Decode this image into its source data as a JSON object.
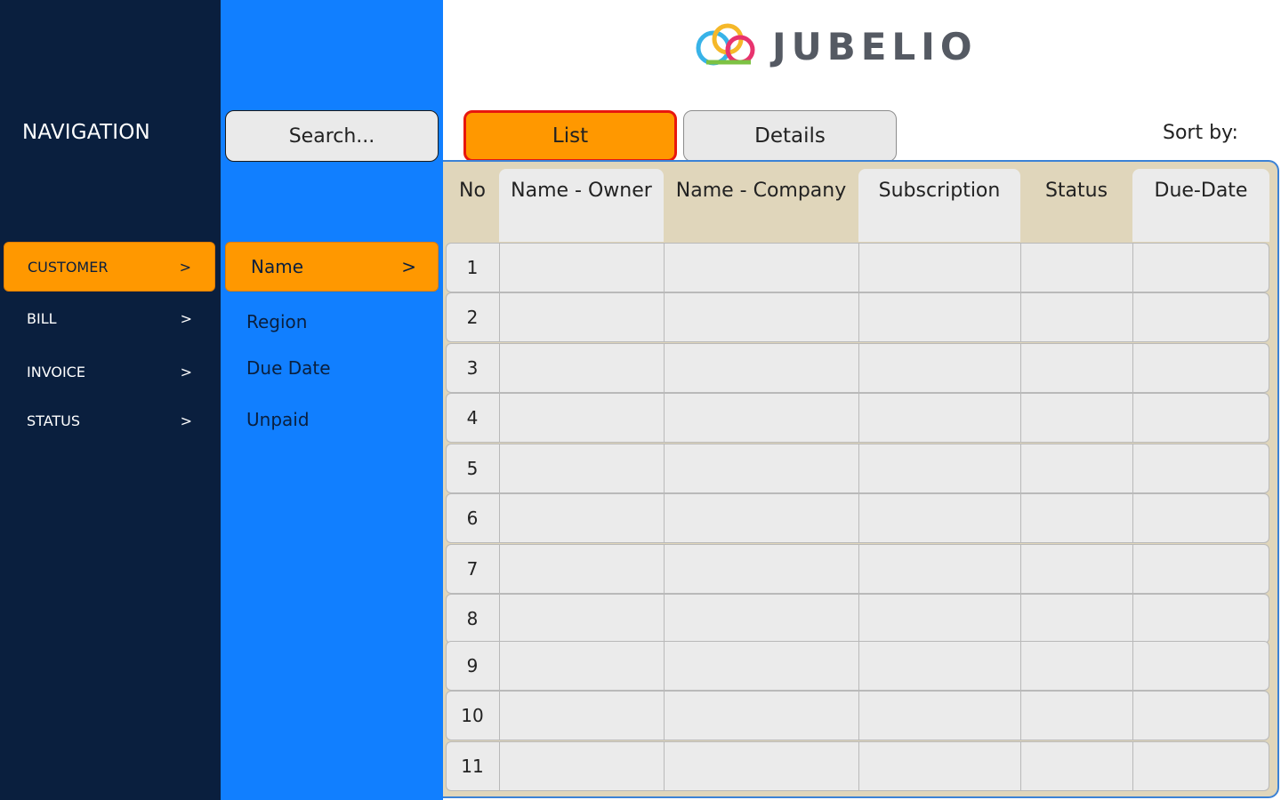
{
  "navigation": {
    "title": "NAVIGATION",
    "items": [
      {
        "label": "CUSTOMER",
        "arrow": ">"
      },
      {
        "label": "BILL",
        "arrow": ">"
      },
      {
        "label": "INVOICE",
        "arrow": ">"
      },
      {
        "label": "STATUS",
        "arrow": ">"
      }
    ]
  },
  "filter": {
    "search_placeholder": "Search...",
    "items": [
      {
        "label": "Name",
        "arrow": ">"
      },
      {
        "label": "Region"
      },
      {
        "label": "Due Date"
      },
      {
        "label": "Unpaid"
      }
    ]
  },
  "logo": {
    "text": "JUBELIO"
  },
  "tabs": [
    {
      "label": "List"
    },
    {
      "label": "Details"
    }
  ],
  "sort": {
    "label": "Sort by:"
  },
  "table": {
    "columns": [
      "No",
      "Name - Owner",
      "Name - Company",
      "Subscription",
      "Status",
      "Due-Date"
    ],
    "rows": [
      "1",
      "2",
      "3",
      "4",
      "5",
      "6",
      "7",
      "8",
      "9",
      "10",
      "11"
    ]
  },
  "colors": {
    "nav_bg": "#0a1f3e",
    "filter_bg": "#117fff",
    "accent": "#ff9800",
    "active_border": "#e8170e",
    "header_bg": "#e0d6bb"
  }
}
